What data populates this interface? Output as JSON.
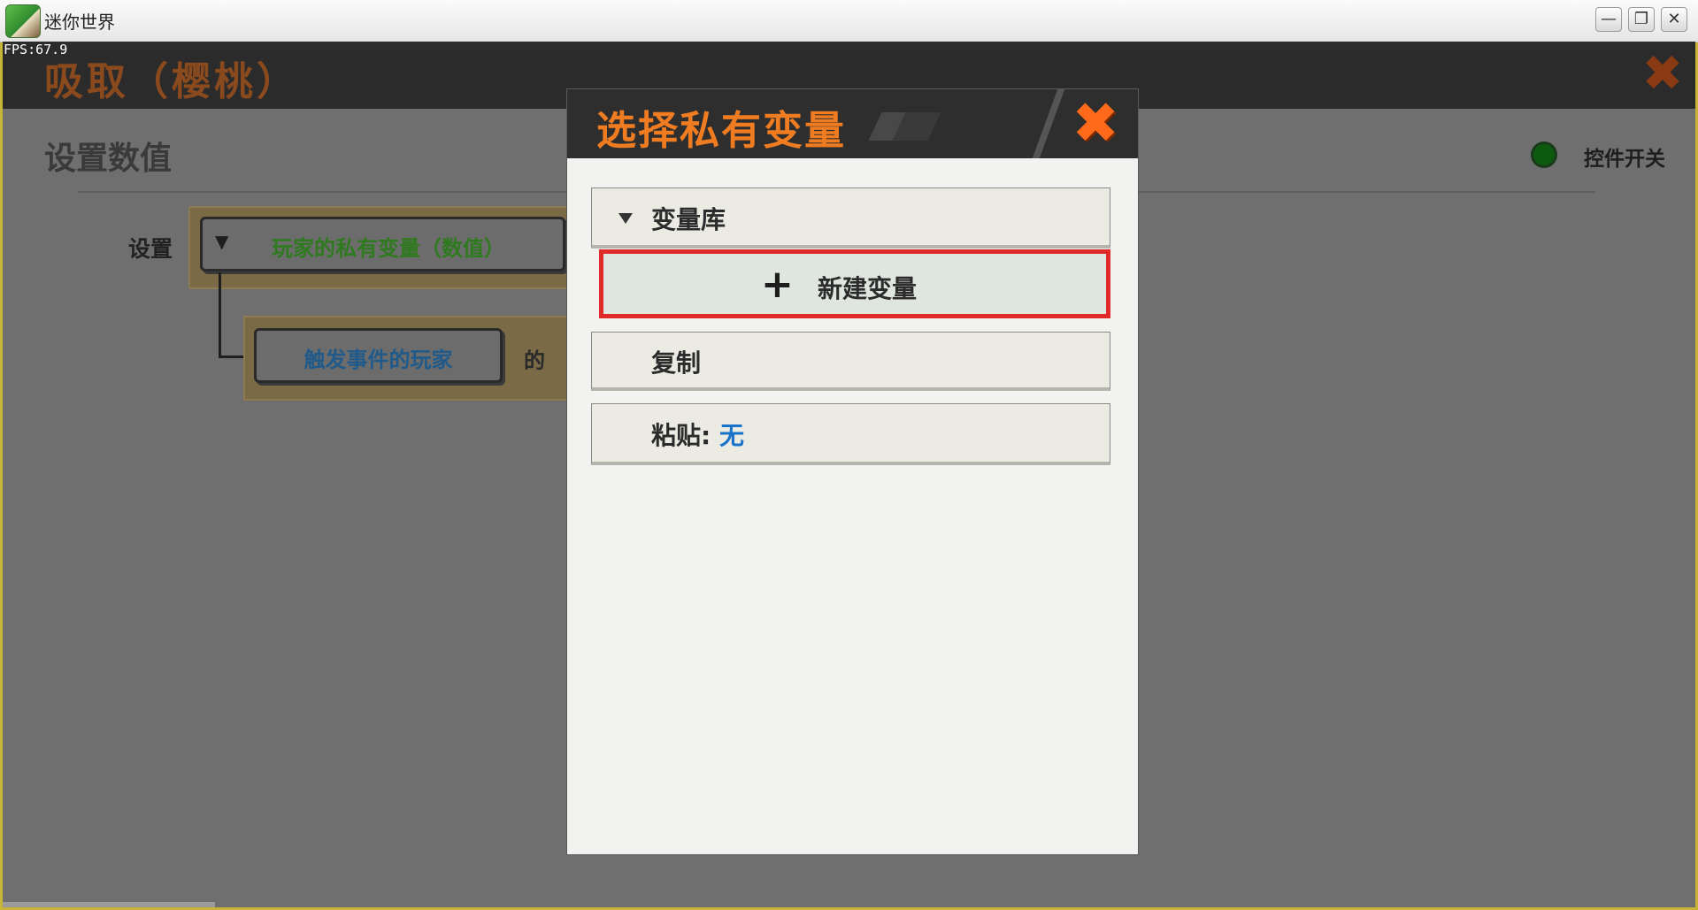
{
  "window": {
    "title": "迷你世界",
    "minimize": "—",
    "restore": "❐",
    "close": "✕"
  },
  "fps": "FPS:67.9",
  "header": {
    "title": "吸取（樱桃）",
    "close_icon": "✖"
  },
  "editor": {
    "section_title": "设置数值",
    "toggle_label": "控件开关",
    "set_label": "设置",
    "variable_block": "玩家的私有变量（数值）",
    "trigger_block": "触发事件的玩家",
    "of_label": "的",
    "dropdown_icon": "▼"
  },
  "dialog": {
    "title": "选择私有变量",
    "close_icon": "✖",
    "library_label": "变量库",
    "new_variable_plus": "+",
    "new_variable_label": "新建变量",
    "copy_label": "复制",
    "paste_label": "粘贴:",
    "paste_value": "无"
  },
  "colors": {
    "dialog_title": "#f07c22",
    "highlight_border": "#e02a2a",
    "paste_value": "#1a73c9",
    "variable_text": "#2e7a1e",
    "trigger_text": "#1f5a8a",
    "toggle_dot": "#0b5a10"
  }
}
